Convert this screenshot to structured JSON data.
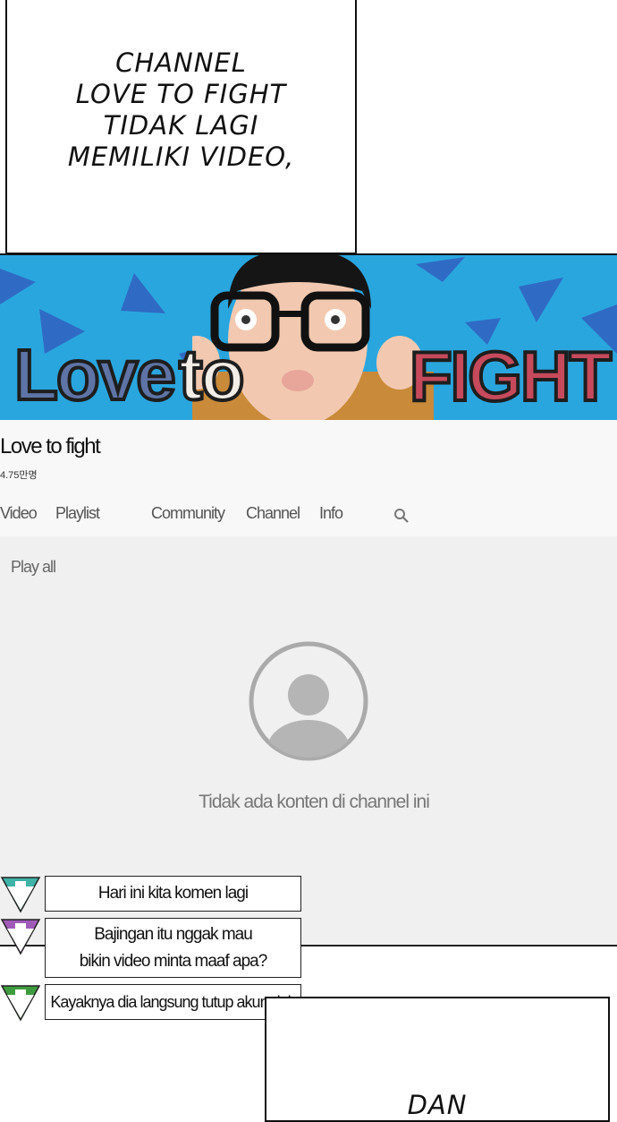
{
  "narration": {
    "top_lines": [
      "CHANNEL",
      "LOVE TO FIGHT",
      "TIDAK LAGI",
      "MEMILIKI VIDEO,"
    ],
    "bottom": "DAN"
  },
  "banner": {
    "word_left": "Love",
    "word_mid": "to",
    "word_right": "FIGHT"
  },
  "channel": {
    "name": "Love to fight",
    "subscribers": "4.75만명"
  },
  "tabs": [
    "Video",
    "Playlist",
    "Community",
    "Channel",
    "Info"
  ],
  "content": {
    "play_all": "Play all",
    "empty_message": "Tidak ada konten di channel ini"
  },
  "comments": [
    {
      "lines": [
        "Hari ini kita komen lagi"
      ],
      "color": "#3fb3a8"
    },
    {
      "lines": [
        "Bajingan itu nggak mau",
        "bikin video minta maaf apa?"
      ],
      "color": "#a05bb8"
    },
    {
      "lines": [
        "Kayaknya dia langsung tutup akun deh"
      ],
      "color": "#3e9c3e"
    }
  ]
}
